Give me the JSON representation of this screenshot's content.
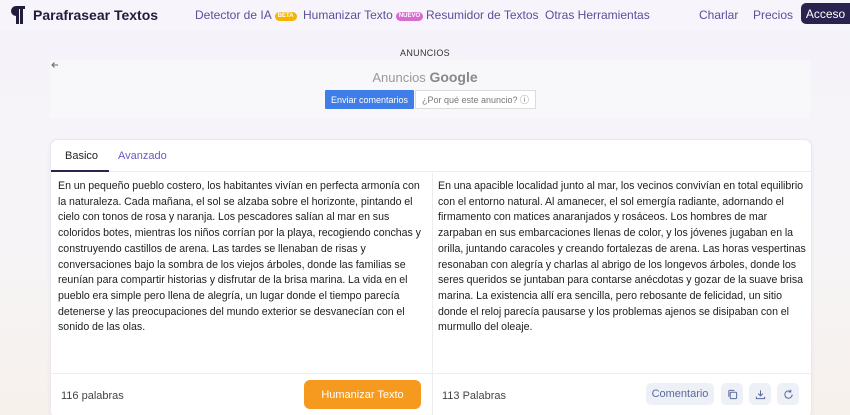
{
  "nav": {
    "brand": "Parafrasear Textos",
    "links": [
      {
        "label": "Detector de IA",
        "badge": "BETA"
      },
      {
        "label": "Humanizar Texto",
        "badge": "NUEVO"
      },
      {
        "label": "Resumidor de Textos"
      },
      {
        "label": "Otras Herramientas"
      }
    ],
    "right_links": [
      "Charlar",
      "Precios"
    ],
    "login": "Acceso"
  },
  "ad": {
    "label": "ANUNCIOS",
    "back_icon": "arrow-left-icon",
    "title_prefix": "Anuncios",
    "title_brand": "Google",
    "send_feedback": "Enviar comentarios",
    "why_ad": "¿Por qué este anuncio? ⓘ"
  },
  "editor": {
    "tabs": [
      "Basico",
      "Avanzado"
    ],
    "active_tab": "Basico",
    "input_text": "En un pequeño pueblo costero, los habitantes vivían en perfecta armonía con la naturaleza. Cada mañana, el sol se alzaba sobre el horizonte, pintando el cielo con tonos de rosa y naranja. Los pescadores salían al mar en sus coloridos botes, mientras los niños corrían por la playa, recogiendo conchas y construyendo castillos de arena. Las tardes se llenaban de risas y conversaciones bajo la sombra de los viejos árboles, donde las familias se reunían para compartir historias y disfrutar de la brisa marina. La vida en el pueblo era simple pero llena de alegría, un lugar donde el tiempo parecía detenerse y las preocupaciones del mundo exterior se desvanecían con el sonido de las olas.",
    "output_text": "En una apacible localidad junto al mar, los vecinos convivían en total equilibrio con el entorno natural. Al amanecer, el sol emergía radiante, adornando el firmamento con matices anaranjados y rosáceos. Los hombres de mar zarpaban en sus embarcaciones llenas de color, y los jóvenes jugaban en la orilla, juntando caracoles y creando fortalezas de arena. Las horas vespertinas resonaban con alegría y charlas al abrigo de los longevos árboles, donde los seres queridos se juntaban para contarse anécdotas y gozar de la suave brisa marina. La existencia allí era sencilla, pero rebosante de felicidad, un sitio donde el reloj parecía pausarse y los problemas ajenos se disipaban con el murmullo del oleaje.",
    "input_count": "116 palabras",
    "output_count": "113 Palabras",
    "humanize_button": "Humanizar Texto",
    "comment_button": "Comentario",
    "action_icons": [
      "copy-icon",
      "download-icon",
      "refresh-icon"
    ]
  },
  "colors": {
    "brand_dark": "#2a2350",
    "accent_orange": "#f59a1e",
    "link_purple": "#5a4f9a",
    "google_blue": "#3f7ee8"
  }
}
